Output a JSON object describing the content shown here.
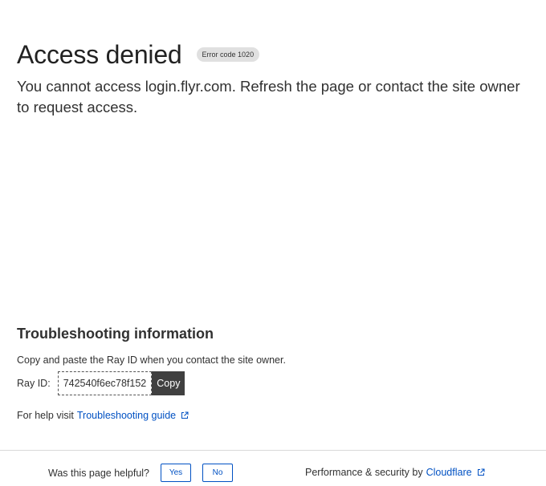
{
  "header": {
    "title": "Access denied",
    "error_code": "Error code 1020",
    "message": "You cannot access login.flyr.com. Refresh the page or contact the site owner to request access."
  },
  "troubleshooting": {
    "heading": "Troubleshooting information",
    "description": "Copy and paste the Ray ID when you contact the site owner.",
    "ray_label": "Ray ID:",
    "ray_id": "742540f6ec78f152",
    "copy_label": "Copy",
    "help_prefix": "For help visit",
    "help_link": "Troubleshooting guide"
  },
  "footer": {
    "helpful_question": "Was this page helpful?",
    "yes_label": "Yes",
    "no_label": "No",
    "powered_prefix": "Performance & security by",
    "powered_link": "Cloudflare"
  },
  "colors": {
    "link": "#0051c3",
    "text": "#313131",
    "copy_button_bg": "#404040",
    "badge_bg": "#e0e0e0"
  },
  "icons": {
    "external_link": "external-link-icon"
  }
}
